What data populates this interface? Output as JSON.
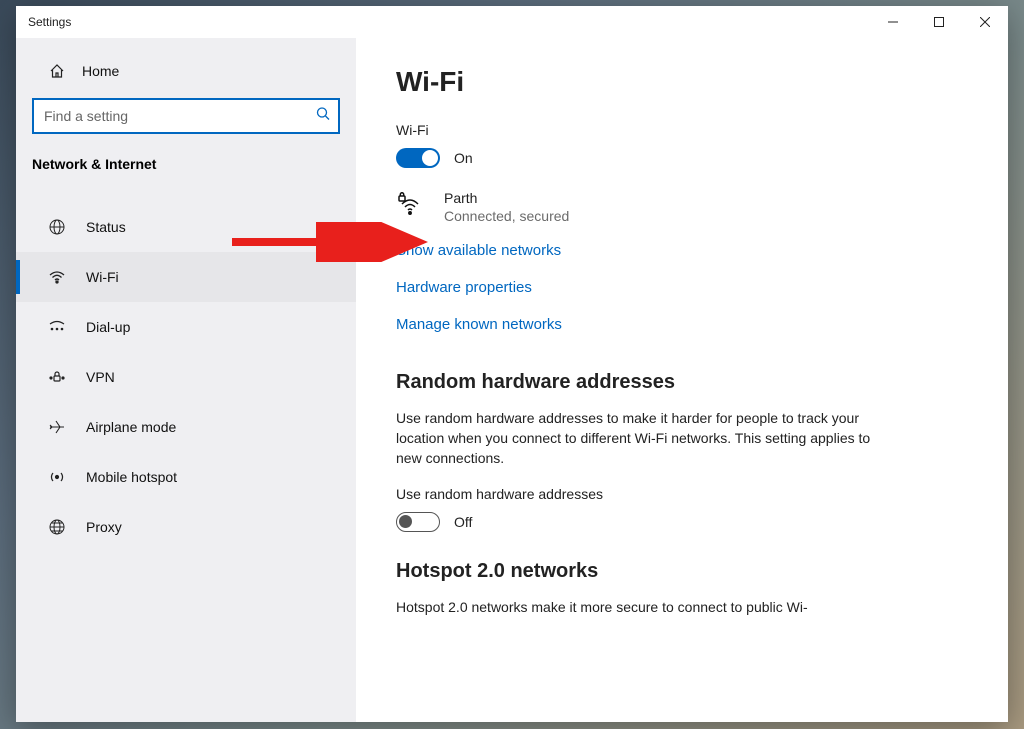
{
  "window": {
    "title": "Settings"
  },
  "sidebar": {
    "home_label": "Home",
    "search_placeholder": "Find a setting",
    "category": "Network & Internet",
    "items": [
      {
        "label": "Status",
        "icon": "globe-grid-icon",
        "selected": false
      },
      {
        "label": "Wi-Fi",
        "icon": "wifi-icon",
        "selected": true
      },
      {
        "label": "Dial-up",
        "icon": "dialup-icon",
        "selected": false
      },
      {
        "label": "VPN",
        "icon": "vpn-icon",
        "selected": false
      },
      {
        "label": "Airplane mode",
        "icon": "airplane-icon",
        "selected": false
      },
      {
        "label": "Mobile hotspot",
        "icon": "hotspot-icon",
        "selected": false
      },
      {
        "label": "Proxy",
        "icon": "proxy-globe-icon",
        "selected": false
      }
    ]
  },
  "main": {
    "title": "Wi-Fi",
    "wifi_toggle": {
      "label": "Wi-Fi",
      "on": true,
      "state_label": "On"
    },
    "network": {
      "name": "Parth",
      "status": "Connected, secured"
    },
    "links": {
      "show_networks": "Show available networks",
      "hardware_props": "Hardware properties",
      "manage_known": "Manage known networks"
    },
    "random_hw": {
      "heading": "Random hardware addresses",
      "desc": "Use random hardware addresses to make it harder for people to track your location when you connect to different Wi-Fi networks. This setting applies to new connections.",
      "toggle_label": "Use random hardware addresses",
      "on": false,
      "state_label": "Off"
    },
    "hotspot20": {
      "heading": "Hotspot 2.0 networks",
      "desc": "Hotspot 2.0 networks make it more secure to connect to public Wi-"
    }
  },
  "colors": {
    "accent": "#0067c0",
    "link": "#0067c0"
  }
}
